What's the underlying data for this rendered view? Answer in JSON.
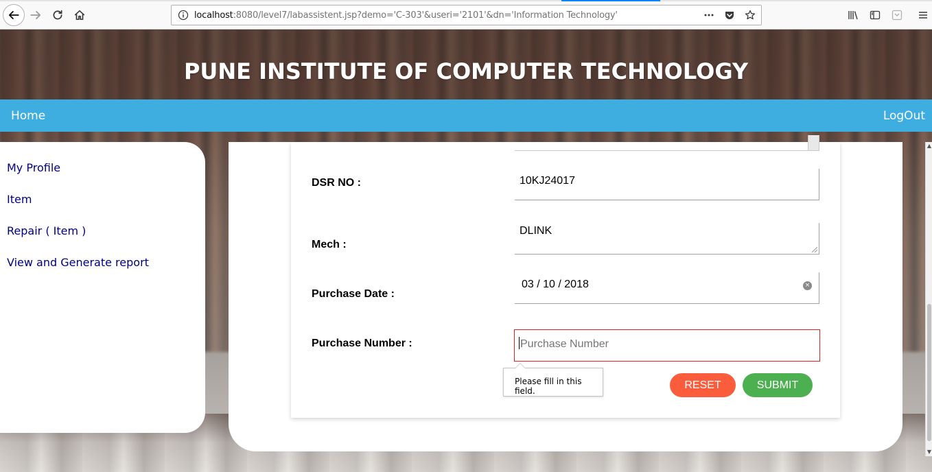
{
  "browser": {
    "url_host": "localhost",
    "url_rest": ":8080/level7/labassistent.jsp?demo='C-303'&useri='2101'&dn='Information Technology'",
    "toolbar_icons": [
      "back-icon",
      "forward-icon",
      "reload-icon",
      "home-icon",
      "info-icon",
      "page-actions-icon",
      "pocket-icon",
      "bookmark-star-icon",
      "library-icon",
      "sidebar-icon",
      "reader-icon",
      "menu-icon"
    ]
  },
  "header": {
    "title": "PUNE INSTITUTE OF COMPUTER TECHNOLOGY"
  },
  "navbar": {
    "home": "Home",
    "logout": "LogOut",
    "color": "#3eaee0"
  },
  "sidebar": {
    "items": [
      {
        "label": "My Profile"
      },
      {
        "label": "Item"
      },
      {
        "label": "Repair ( Item )"
      },
      {
        "label": "View and Generate report"
      }
    ]
  },
  "form": {
    "dsr": {
      "label": "DSR NO :",
      "value": "10KJ24017"
    },
    "mech": {
      "label": "Mech :",
      "value": "DLINK"
    },
    "purchase_date": {
      "label": "Purchase Date :",
      "value": "03 / 10 / 2018"
    },
    "purchase_number": {
      "label": "Purchase Number :",
      "placeholder": "Purchase Number",
      "value": ""
    },
    "validation_message": "Please fill in this field.",
    "reset_label": "RESET",
    "submit_label": "SUBMIT",
    "reset_color": "#fa5c3c",
    "submit_color": "#4caf50",
    "invalid_border_color": "#e02020"
  }
}
